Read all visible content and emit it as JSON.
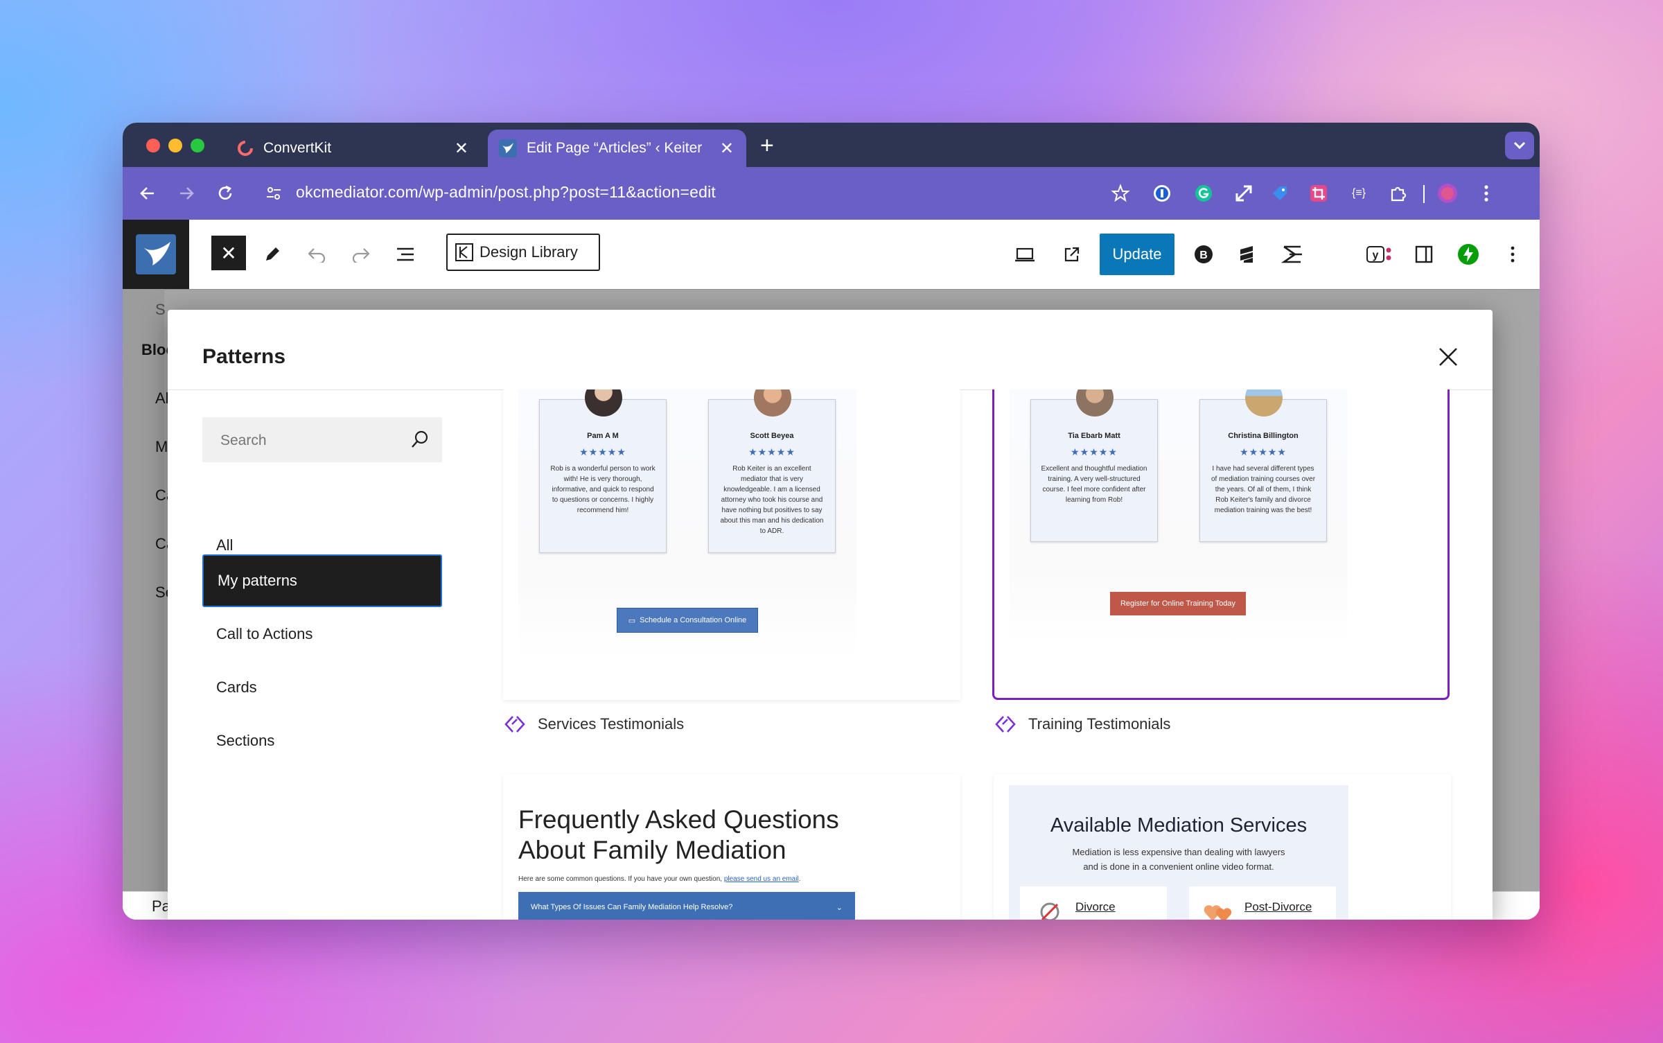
{
  "browser": {
    "tabs": [
      {
        "title": "ConvertKit",
        "active": false
      },
      {
        "title": "Edit Page “Articles” ‹ Keiter Mediation",
        "active": true
      }
    ],
    "close_glyph": "✕",
    "new_tab_glyph": "+",
    "url": "okcmediator.com/wp-admin/post.php?post=11&action=edit"
  },
  "editor": {
    "close_glyph": "✕",
    "design_library_label": "Design Library",
    "update_label": "Update",
    "footer_breadcrumb": "Page",
    "sidebar_fragments": [
      "S",
      "Bloc",
      "Al",
      "M",
      "Ca",
      "Ca",
      "Se"
    ]
  },
  "modal": {
    "title": "Patterns",
    "search_placeholder": "Search",
    "categories": [
      {
        "label": "All",
        "active": false
      },
      {
        "label": "My patterns",
        "active": true
      },
      {
        "label": "Call to Actions",
        "active": false
      },
      {
        "label": "Cards",
        "active": false
      },
      {
        "label": "Sections",
        "active": false
      }
    ],
    "patterns": [
      {
        "label": "Services Testimonials",
        "cards": [
          {
            "name": "Pam A M",
            "text": "Rob is a wonderful person to work with! He is very thorough, informative, and quick to respond to questions or concerns. I highly recommend him!"
          },
          {
            "name": "Scott Beyea",
            "text": "Rob Keiter is an excellent mediator that is very knowledgeable. I am a licensed attorney who took his course and have nothing but positives to say about this man and his dedication to ADR."
          }
        ],
        "cta": "Schedule a Consultation Online"
      },
      {
        "label": "Training Testimonials",
        "cards": [
          {
            "name": "Tia Ebarb Matt",
            "text": "Excellent and thoughtful mediation training. A very well-structured course. I feel more confident after learning from Rob!"
          },
          {
            "name": "Christina Billington",
            "text": "I have had several different types of mediation training courses over the years. Of all of them, I think Rob Keiter's family and divorce mediation training was the best!"
          }
        ],
        "cta": "Register for Online Training Today"
      }
    ],
    "stars": "★★★★★",
    "faq": {
      "title": "Frequently Asked Questions About Family Mediation",
      "subtitle": "Here are some common questions. If you have your own question, ",
      "subtitle_link": "please send us an email",
      "subtitle_end": ".",
      "accordion_first": "What Types Of Issues Can Family Mediation Help Resolve?"
    },
    "services": {
      "title": "Available Mediation Services",
      "description_line1": "Mediation is less expensive than dealing with lawyers",
      "description_line2": "and is done in a convenient online video format.",
      "items": [
        "Divorce",
        "Post-Divorce"
      ]
    }
  },
  "colors": {
    "tab_strip": "#2d3552",
    "toolbar": "#6a5fc4",
    "update_button": "#0a78b8",
    "selected_pattern_border": "#7b1fbf",
    "pattern_icon": "#7b2fd6",
    "services_cta": "#4c78bd",
    "training_cta": "#c0584a"
  }
}
